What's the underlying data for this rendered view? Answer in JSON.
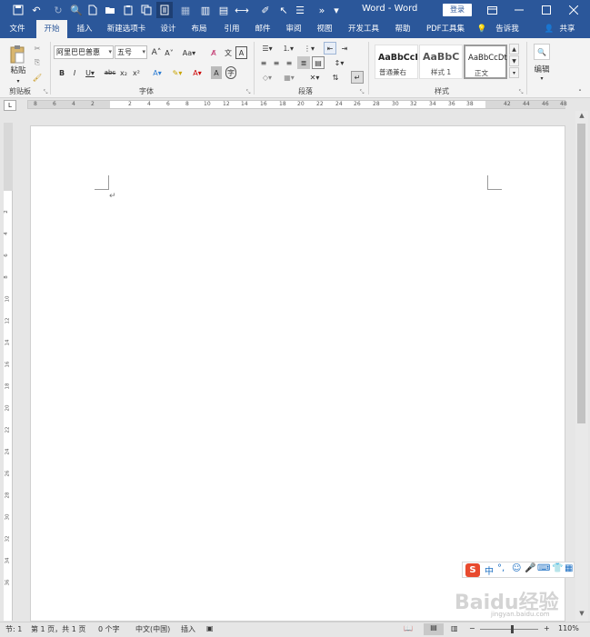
{
  "titlebar": {
    "title": "Word - Word",
    "login": "登录",
    "icons": [
      "save-icon",
      "undo-icon",
      "redo-icon",
      "print-preview-icon",
      "new-doc-icon",
      "open-icon",
      "paste-icon",
      "copy-icon",
      "read-mode-icon"
    ]
  },
  "tabs": [
    "文件",
    "开始",
    "插入",
    "新建选项卡",
    "设计",
    "布局",
    "引用",
    "邮件",
    "审阅",
    "视图",
    "开发工具",
    "帮助",
    "PDF工具集"
  ],
  "tell_me": "告诉我",
  "share": "共享",
  "ribbon": {
    "paste": "粘贴",
    "clipboard": "剪贴板",
    "font_name": "阿里巴巴普惠",
    "font_size": "五号",
    "font_group": "字体",
    "paragraph_group": "段落",
    "styles_group": "样式",
    "styles": [
      {
        "preview": "AaBbCcI",
        "name": "普通兼右"
      },
      {
        "preview": "AaBbC",
        "name": "样式 1"
      },
      {
        "preview": "AaBbCcDt",
        "name": "正文"
      }
    ],
    "edit": "编辑"
  },
  "ruler_numbers": [
    "8",
    "6",
    "4",
    "2",
    "2",
    "4",
    "6",
    "8",
    "10",
    "12",
    "14",
    "16",
    "18",
    "20",
    "22",
    "24",
    "26",
    "28",
    "30",
    "32",
    "34",
    "36",
    "38",
    "42",
    "44",
    "46",
    "48"
  ],
  "vruler_numbers": [
    "2",
    "4",
    "6",
    "8",
    "10",
    "12",
    "14",
    "16",
    "18",
    "20",
    "22",
    "24",
    "26",
    "28",
    "30",
    "32",
    "34",
    "36"
  ],
  "status": {
    "section": "节: 1",
    "page": "第 1 页，共 1 页",
    "words": "0 个字",
    "language": "中文(中国)",
    "mode": "插入",
    "zoom": "110%"
  },
  "ime": {
    "logo": "S",
    "mode": "中"
  },
  "watermark": "Baidu经验",
  "watermark_url": "jingyan.baidu.com"
}
